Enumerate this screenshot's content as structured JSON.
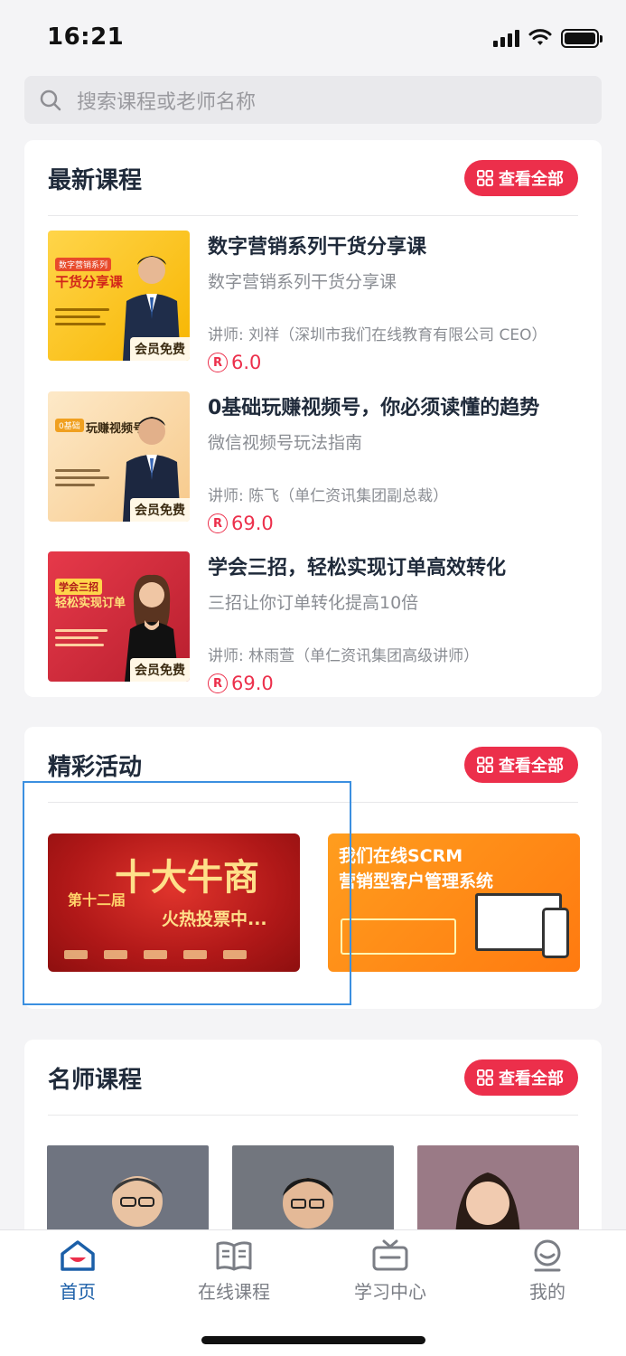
{
  "status_bar": {
    "time": "16:21"
  },
  "search": {
    "placeholder": "搜索课程或老师名称"
  },
  "colors": {
    "accent": "#ec2f4b",
    "tab_active": "#1b5fa8"
  },
  "latest_courses": {
    "title": "最新课程",
    "view_all": "查看全部",
    "items": [
      {
        "title": "数字营销系列干货分享课",
        "subtitle": "数字营销系列干货分享课",
        "teacher": "讲师: 刘祥（深圳市我们在线教育有限公司 CEO）",
        "price": "6.0",
        "badge": "会员免费",
        "thumb_tag": "数字营销系列",
        "thumb_head": "干货分享课"
      },
      {
        "title": "0基础玩赚视频号，你必须读懂的趋势",
        "subtitle": "微信视频号玩法指南",
        "teacher": "讲师: 陈飞（单仁资讯集团副总裁）",
        "price": "69.0",
        "badge": "会员免费",
        "thumb_tag": "0基础",
        "thumb_head": "玩赚视频号"
      },
      {
        "title": "学会三招，轻松实现订单高效转化",
        "subtitle": "三招让你订单转化提高10倍",
        "teacher": "讲师: 林雨萱（单仁资讯集团高级讲师）",
        "price": "69.0",
        "badge": "会员免费",
        "thumb_tag": "学会三招",
        "thumb_head": "轻松实现订单"
      }
    ]
  },
  "activities": {
    "title": "精彩活动",
    "view_all": "查看全部",
    "banner1": {
      "left_text": "第十二届",
      "big_text": "十大牛商",
      "sub_text": "火热投票中..."
    },
    "banner2": {
      "line1": "我们在线SCRM",
      "line2": "营销型客户管理系统"
    }
  },
  "teachers": {
    "title": "名师课程",
    "view_all": "查看全部"
  },
  "tab_bar": {
    "home": "首页",
    "courses": "在线课程",
    "study": "学习中心",
    "me": "我的"
  },
  "price_symbol": "R"
}
